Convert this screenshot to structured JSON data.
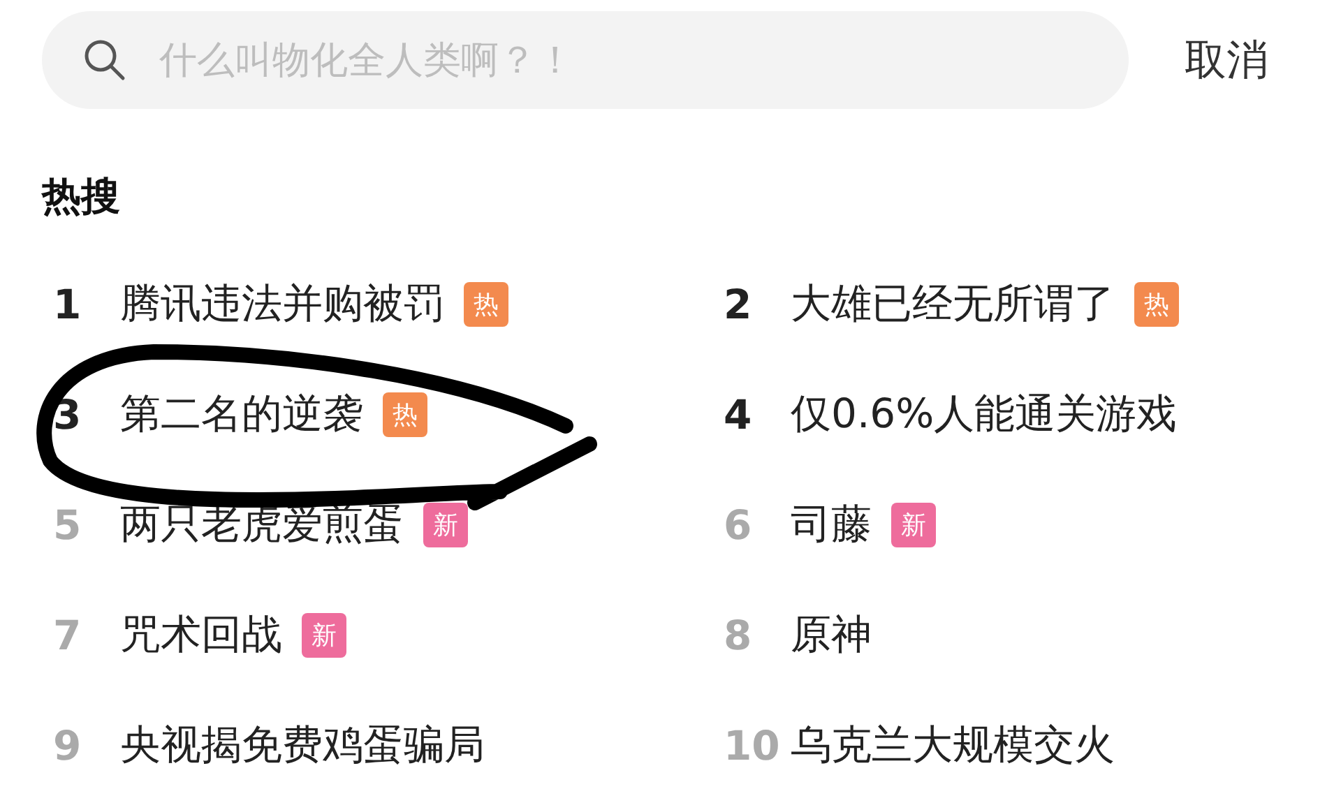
{
  "search": {
    "placeholder": "什么叫物化全人类啊？！"
  },
  "cancel": "取消",
  "section_title": "热搜",
  "items": [
    {
      "rank": "1",
      "title": "腾讯违法并购被罚",
      "top": true,
      "badge": {
        "kind": "hot",
        "text": "热"
      }
    },
    {
      "rank": "2",
      "title": "大雄已经无所谓了",
      "top": true,
      "badge": {
        "kind": "hot",
        "text": "热"
      }
    },
    {
      "rank": "3",
      "title": "第二名的逆袭",
      "top": true,
      "badge": {
        "kind": "hot",
        "text": "热"
      }
    },
    {
      "rank": "4",
      "title": "仅0.6%人能通关游戏",
      "top": true
    },
    {
      "rank": "5",
      "title": "两只老虎爱煎蛋",
      "top": false,
      "badge": {
        "kind": "new",
        "text": "新"
      }
    },
    {
      "rank": "6",
      "title": "司藤",
      "top": false,
      "badge": {
        "kind": "new",
        "text": "新"
      }
    },
    {
      "rank": "7",
      "title": "咒术回战",
      "top": false,
      "badge": {
        "kind": "new",
        "text": "新"
      }
    },
    {
      "rank": "8",
      "title": "原神",
      "top": false
    },
    {
      "rank": "9",
      "title": "央视揭免费鸡蛋骗局",
      "top": false
    },
    {
      "rank": "10",
      "title": "乌克兰大规模交火",
      "top": false
    }
  ]
}
